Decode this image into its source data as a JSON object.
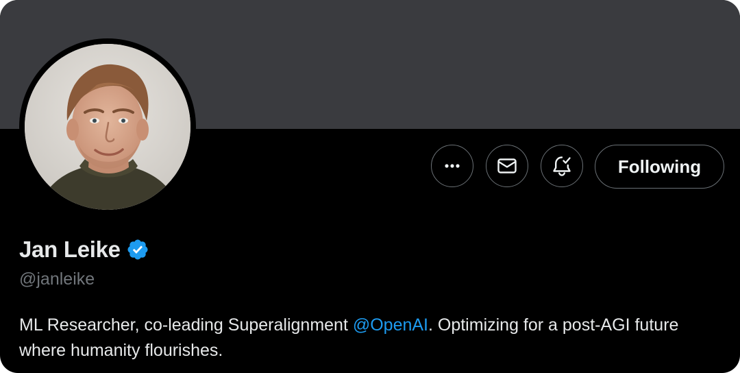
{
  "profile": {
    "display_name": "Jan Leike",
    "handle": "@janleike",
    "verified": true,
    "verified_icon": "verified-badge-icon",
    "verified_color": "#1d9bf0",
    "bio_before": "ML Researcher, co-leading Superalignment ",
    "bio_mention": "@OpenAI",
    "bio_after": ". Optimizing for a post-AGI future where humanity flourishes."
  },
  "actions": {
    "more_icon": "more-horizontal-icon",
    "message_icon": "envelope-icon",
    "notify_icon": "bell-check-icon",
    "follow_label": "Following"
  },
  "colors": {
    "banner": "#3a3b3f",
    "background": "#000000",
    "mention": "#1d9bf0",
    "secondary_text": "#71767b"
  }
}
